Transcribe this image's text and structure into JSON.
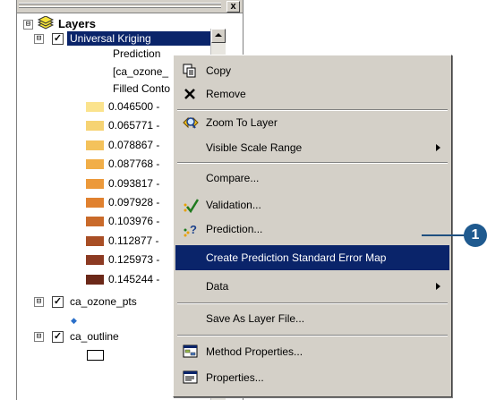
{
  "toc": {
    "root_label": "Layers",
    "layers": [
      {
        "name": "Universal Kriging",
        "checked": true,
        "legend_lines": [
          "Prediction",
          "[ca_ozone_",
          "Filled Conto"
        ],
        "classes": [
          {
            "label": "0.046500 -",
            "color": "#fbe38d"
          },
          {
            "label": "0.065771 -",
            "color": "#f6d373"
          },
          {
            "label": "0.078867 -",
            "color": "#f4c25b"
          },
          {
            "label": "0.087768 -",
            "color": "#f1ae48"
          },
          {
            "label": "0.093817 -",
            "color": "#ec993a"
          },
          {
            "label": "0.097928 -",
            "color": "#e0812f"
          },
          {
            "label": "0.103976 -",
            "color": "#c96a2a"
          },
          {
            "label": "0.112877 -",
            "color": "#a84e25"
          },
          {
            "label": "0.125973 -",
            "color": "#8c3a22"
          },
          {
            "label": "0.145244 -",
            "color": "#6b2818"
          }
        ]
      },
      {
        "name": "ca_ozone_pts",
        "checked": true
      },
      {
        "name": "ca_outline",
        "checked": true
      }
    ],
    "close_glyph": "x",
    "expander_glyph": "⊟",
    "check_glyph": "✓",
    "point_symbol": "◆",
    "point_symbol_color": "#2a6fc9"
  },
  "menu": {
    "items": [
      {
        "label": "Copy",
        "icon": "copy-icon",
        "glyph": "⎘"
      },
      {
        "label": "Remove",
        "icon": "remove-icon",
        "glyph": "✕"
      },
      {
        "label": "Zoom To Layer",
        "icon": "zoom-to-layer-icon",
        "glyph": "🔍"
      },
      {
        "label": "Visible Scale Range",
        "submenu": true
      },
      {
        "label": "Compare..."
      },
      {
        "label": "Validation...",
        "icon": "validation-icon",
        "glyph": "✔"
      },
      {
        "label": "Prediction...",
        "icon": "prediction-icon",
        "glyph": "?"
      },
      {
        "label": "Create Prediction Standard Error Map",
        "highlighted": true
      },
      {
        "label": "Data",
        "submenu": true
      },
      {
        "label": "Save As Layer File..."
      },
      {
        "label": "Method Properties...",
        "icon": "method-properties-icon",
        "glyph": "▦"
      },
      {
        "label": "Properties...",
        "icon": "properties-icon",
        "glyph": "▤"
      }
    ]
  },
  "callout": {
    "number": "1",
    "color": "#1f5a8f"
  },
  "colors": {
    "selection": "#0a246a",
    "menu_bg": "#d4d0c8"
  }
}
